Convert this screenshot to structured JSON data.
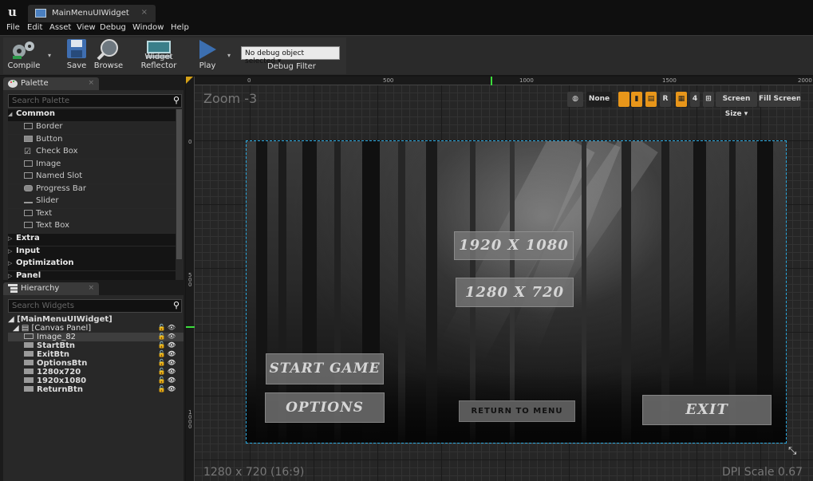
{
  "window": {
    "tab_title": "MainMenuUIWidget",
    "tab_close": "×"
  },
  "menu": [
    "File",
    "Edit",
    "Asset",
    "View",
    "Debug",
    "Window",
    "Help"
  ],
  "toolbar": {
    "compile": "Compile",
    "save": "Save",
    "browse": "Browse",
    "widget_reflector": "Widget Reflector",
    "play": "Play",
    "debug_select": "No debug object selected ▾",
    "debug_filter": "Debug Filter"
  },
  "palette": {
    "tab_label": "Palette",
    "search_placeholder": "Search Palette",
    "categories_top": [
      {
        "label": "Common",
        "arrow": "◢"
      }
    ],
    "common_items": [
      "Border",
      "Button",
      "Check Box",
      "Image",
      "Named Slot",
      "Progress Bar",
      "Slider",
      "Text",
      "Text Box"
    ],
    "categories_bottom": [
      {
        "label": "Extra",
        "arrow": "▷"
      },
      {
        "label": "Input",
        "arrow": "▷"
      },
      {
        "label": "Optimization",
        "arrow": "▷"
      },
      {
        "label": "Panel",
        "arrow": "▷"
      }
    ]
  },
  "hierarchy": {
    "tab_label": "Hierarchy",
    "search_placeholder": "Search Widgets",
    "root": "◢ [MainMenuUIWidget]",
    "canvas": "◢ ▤ [Canvas Panel]",
    "items": [
      "Image_82",
      "StartBtn",
      "ExitBtn",
      "OptionsBtn",
      "1280x720",
      "1920x1080",
      "ReturnBtn"
    ],
    "row_controls": "🔓👁"
  },
  "designer": {
    "zoom": "Zoom -3",
    "resolution": "1280 x 720 (16:9)",
    "dpi_scale": "DPI Scale 0.67",
    "ruler_top": [
      "0",
      "500",
      "1000",
      "1500",
      "2000"
    ],
    "ruler_left": [
      "0",
      "5 0 0",
      "1 0 0 0"
    ],
    "viewport": {
      "none_btn": "None",
      "r_btn": "R",
      "grid_num": "4",
      "screen_size": "Screen Size ▾",
      "fill_screen": "Fill Screen"
    },
    "accent_color": "#29a9e0",
    "highlight_color": "#e8961a"
  },
  "game_ui": {
    "btn_1920": "1920 X 1080",
    "btn_1280": "1280 X 720",
    "start": "START GAME",
    "options": "OPTIONS",
    "return": "RETURN TO MENU",
    "exit": "EXIT"
  }
}
